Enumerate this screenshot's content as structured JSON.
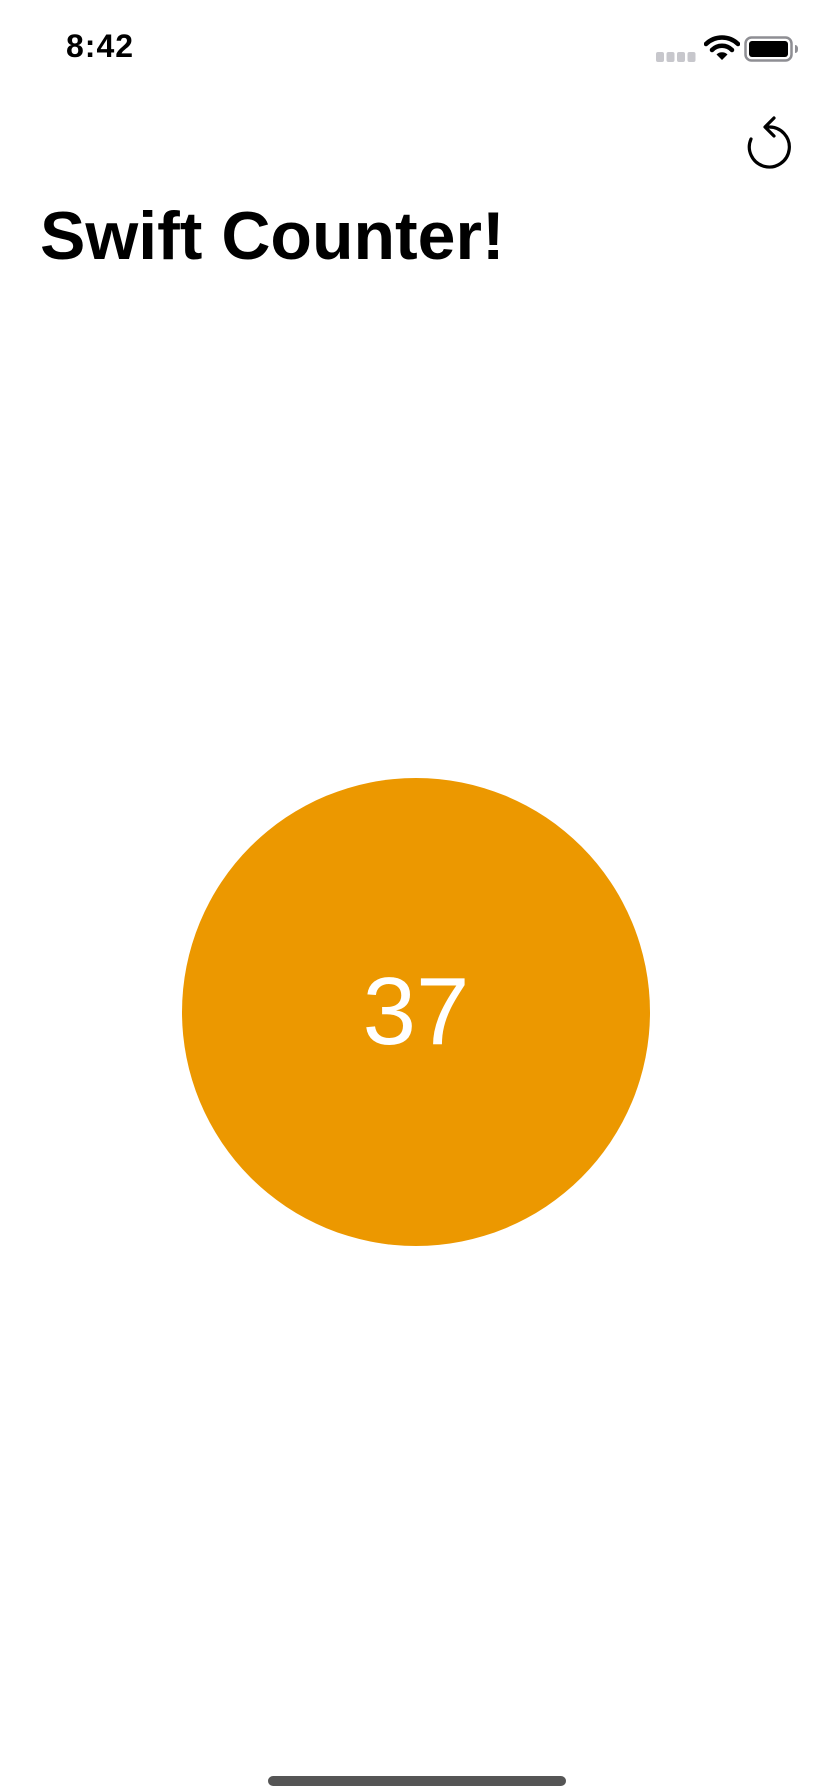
{
  "status_bar": {
    "time": "8:42",
    "icons": [
      "signal-icon",
      "wifi-icon",
      "battery-icon"
    ]
  },
  "toolbar": {
    "reset_icon": "reset-icon"
  },
  "title": "Swift Counter!",
  "counter": {
    "value": "37",
    "color": "#EC9800"
  },
  "colors": {
    "background": "#FFFFFF",
    "text": "#000000",
    "counter_text": "#FFFFFF"
  }
}
